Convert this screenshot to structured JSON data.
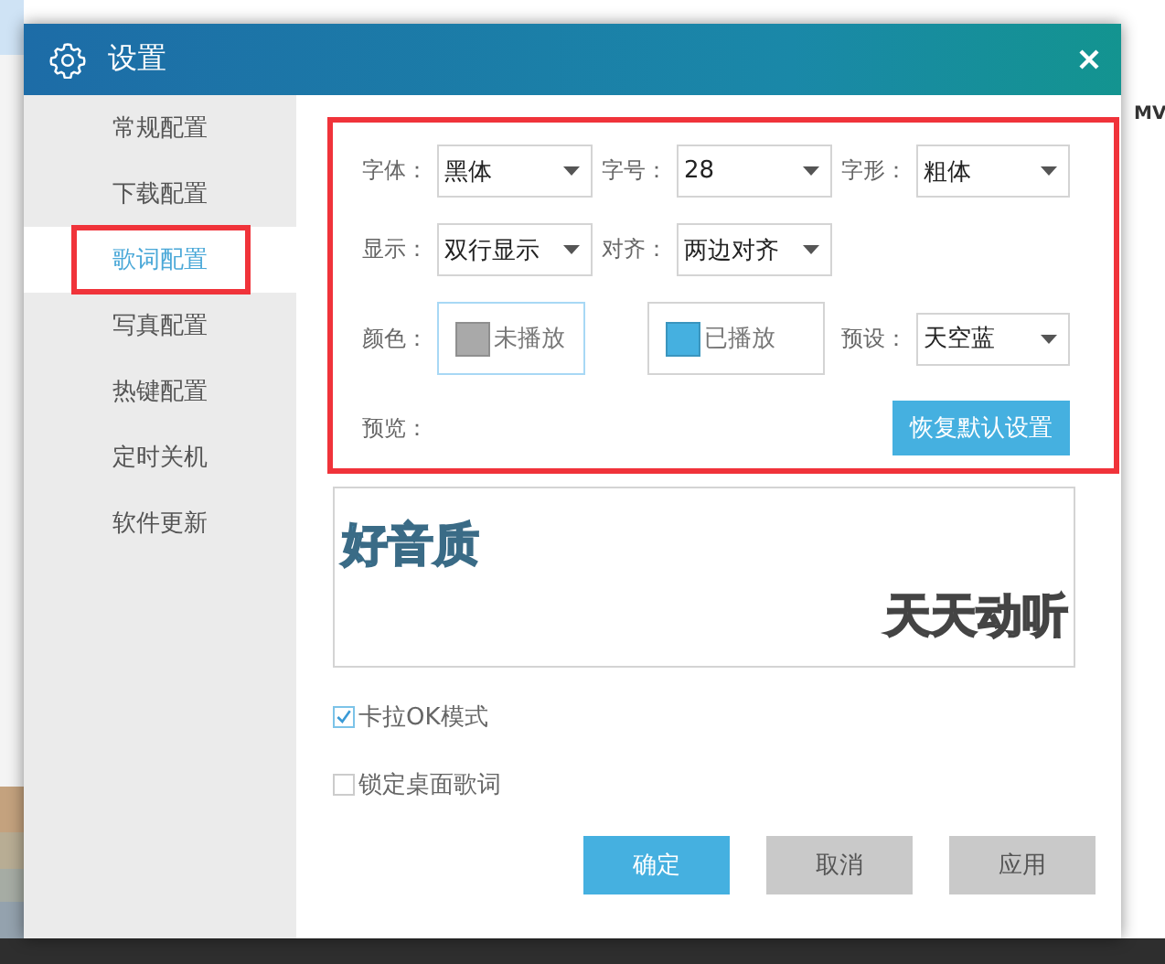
{
  "window": {
    "title": "设置"
  },
  "background": {
    "text": "MV"
  },
  "sidebar": {
    "items": [
      {
        "label": "常规配置",
        "selected": false,
        "highlighted": false
      },
      {
        "label": "下载配置",
        "selected": false,
        "highlighted": false
      },
      {
        "label": "歌词配置",
        "selected": true,
        "highlighted": true
      },
      {
        "label": "写真配置",
        "selected": false,
        "highlighted": false
      },
      {
        "label": "热键配置",
        "selected": false,
        "highlighted": false
      },
      {
        "label": "定时关机",
        "selected": false,
        "highlighted": false
      },
      {
        "label": "软件更新",
        "selected": false,
        "highlighted": false
      }
    ]
  },
  "settings": {
    "highlighted": true,
    "rows": [
      [
        {
          "kind": "select",
          "label": "字体：",
          "value": "黑体"
        },
        {
          "kind": "select",
          "label": "字号：",
          "value": "28"
        },
        {
          "kind": "select",
          "label": "字形：",
          "value": "粗体"
        }
      ],
      [
        {
          "kind": "select",
          "label": "显示：",
          "value": "双行显示"
        },
        {
          "kind": "select",
          "label": "对齐：",
          "value": "两边对齐"
        }
      ],
      [
        {
          "kind": "swatch",
          "label": "颜色：",
          "text": "未播放",
          "color": "#a9a9a9",
          "selected": true
        },
        {
          "kind": "swatch",
          "text": "已播放",
          "color": "#45b0e0",
          "selected": false
        },
        {
          "kind": "select",
          "label": "预设：",
          "value": "天空蓝"
        }
      ],
      [
        {
          "kind": "label",
          "text": "预览："
        },
        {
          "kind": "button",
          "text": "恢复默认设置"
        }
      ]
    ]
  },
  "preview": {
    "line1": "好音质",
    "line2": "天天动听"
  },
  "options": [
    {
      "label": "卡拉OK模式",
      "checked": true
    },
    {
      "label": "锁定桌面歌词",
      "checked": false
    }
  ],
  "buttons": [
    {
      "label": "确定",
      "kind": "primary"
    },
    {
      "label": "取消",
      "kind": "secondary"
    },
    {
      "label": "应用",
      "kind": "secondary"
    }
  ]
}
